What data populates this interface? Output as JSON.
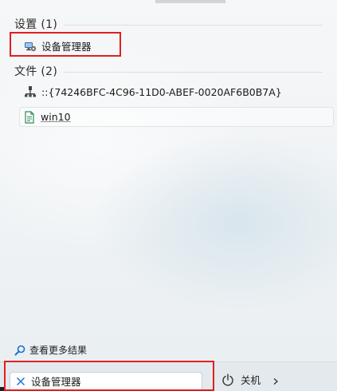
{
  "sections": {
    "settings": {
      "header": "设置 (1)",
      "items": [
        {
          "label": "设备管理器",
          "icon": "device-manager-icon"
        }
      ]
    },
    "files": {
      "header": "文件 (2)",
      "items": [
        {
          "label": "::{74246BFC-4C96-11D0-ABEF-0020AF6B0B7A}",
          "icon": "network-icon"
        },
        {
          "label": "win10",
          "icon": "document-icon"
        }
      ]
    }
  },
  "see_more": {
    "label": "查看更多结果",
    "icon": "search-icon"
  },
  "search": {
    "value": "设备管理器",
    "clear_icon": "close-icon"
  },
  "power": {
    "label": "关机",
    "icon": "power-icon",
    "arrow_icon": "chevron-right-icon"
  },
  "colors": {
    "accent": "#1a6fd1",
    "highlight": "#e02020"
  }
}
